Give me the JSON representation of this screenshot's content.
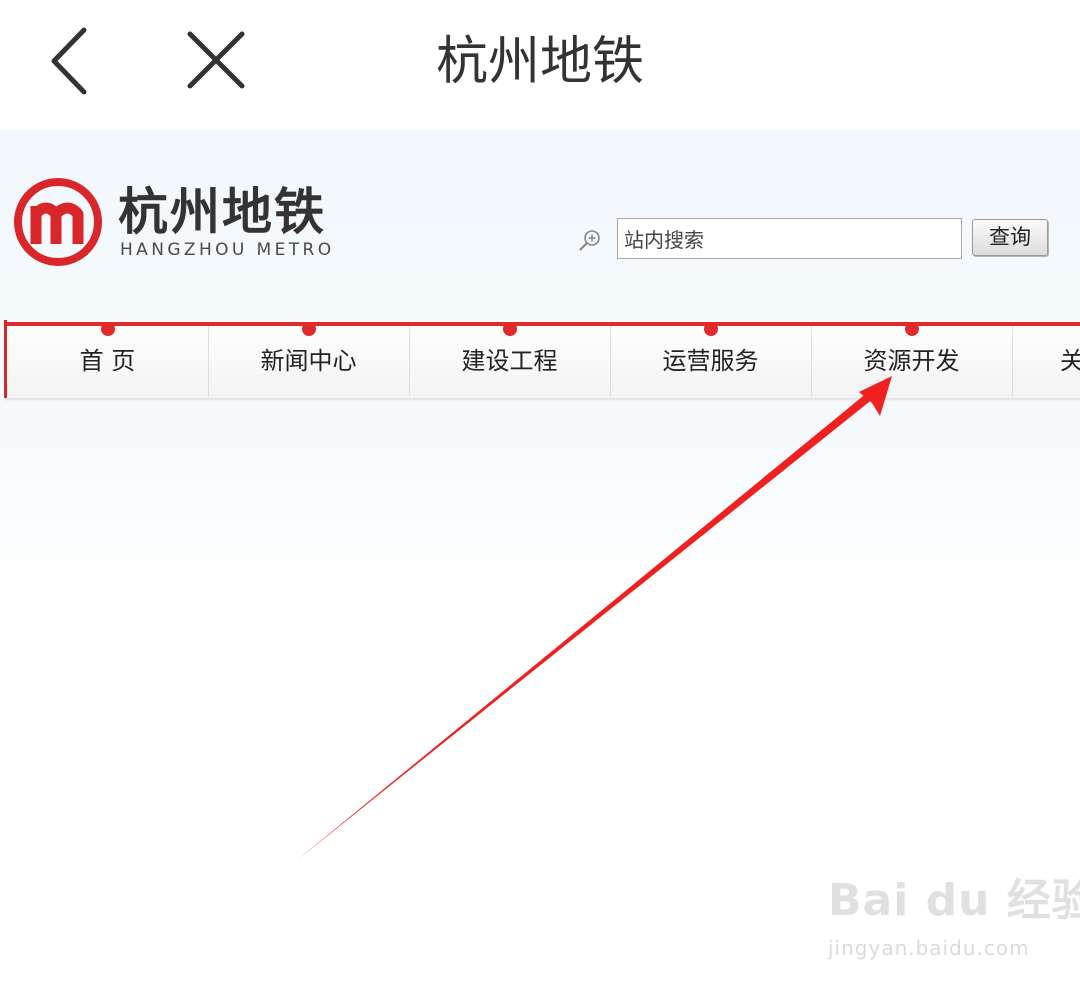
{
  "app_bar": {
    "title": "杭州地铁",
    "back_icon": "chevron-left-icon",
    "close_icon": "close-icon"
  },
  "site": {
    "brand_cn": "杭州地铁",
    "brand_en": "HANGZHOU METRO",
    "logo_color": "#d8262a"
  },
  "search": {
    "placeholder": "站内搜索",
    "value": "站内搜索",
    "button_label": "查询",
    "icon": "magnifier-plus-icon"
  },
  "nav": {
    "accent_color": "#e02a2c",
    "items": [
      {
        "label": "首 页"
      },
      {
        "label": "新闻中心"
      },
      {
        "label": "建设工程"
      },
      {
        "label": "运营服务"
      },
      {
        "label": "资源开发"
      },
      {
        "label": "关"
      }
    ]
  },
  "annotation": {
    "type": "red-arrow",
    "color": "#f02020",
    "points_to": "资源开发"
  },
  "watermark": {
    "logo_text": "Bai du 经验",
    "url": "jingyan.baidu.com"
  }
}
